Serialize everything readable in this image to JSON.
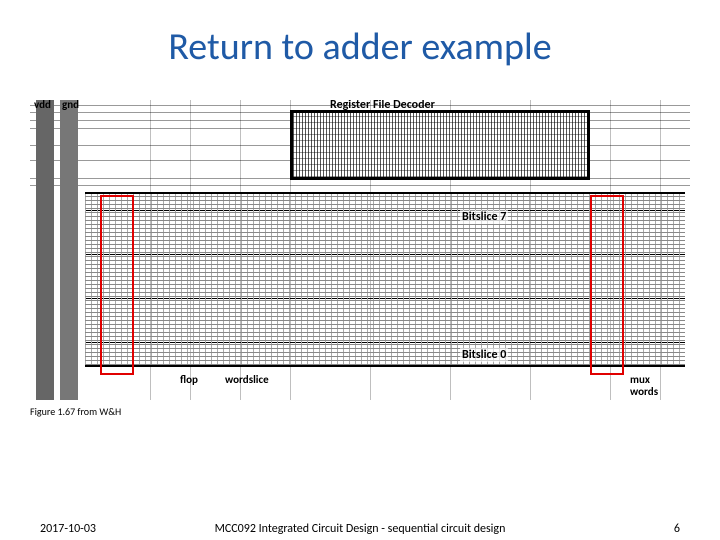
{
  "title": "Return to adder example",
  "figure": {
    "rail_vdd_label": "vdd",
    "rail_gnd_label": "gnd",
    "decoder_label": "Register File Decoder",
    "bitslice_top_label": "Bitslice 7",
    "bitslice_bottom_label": "Bitslice 0",
    "annot_flop": "flop",
    "annot_wordslice_left": "wordslice",
    "annot_mux": "mux",
    "annot_wordslice_right": "words"
  },
  "caption": "Figure 1.67 from W&H",
  "footer": {
    "date": "2017-10-03",
    "course": "MCC092 Integrated Circuit Design - sequential circuit design",
    "page_number": "6"
  }
}
